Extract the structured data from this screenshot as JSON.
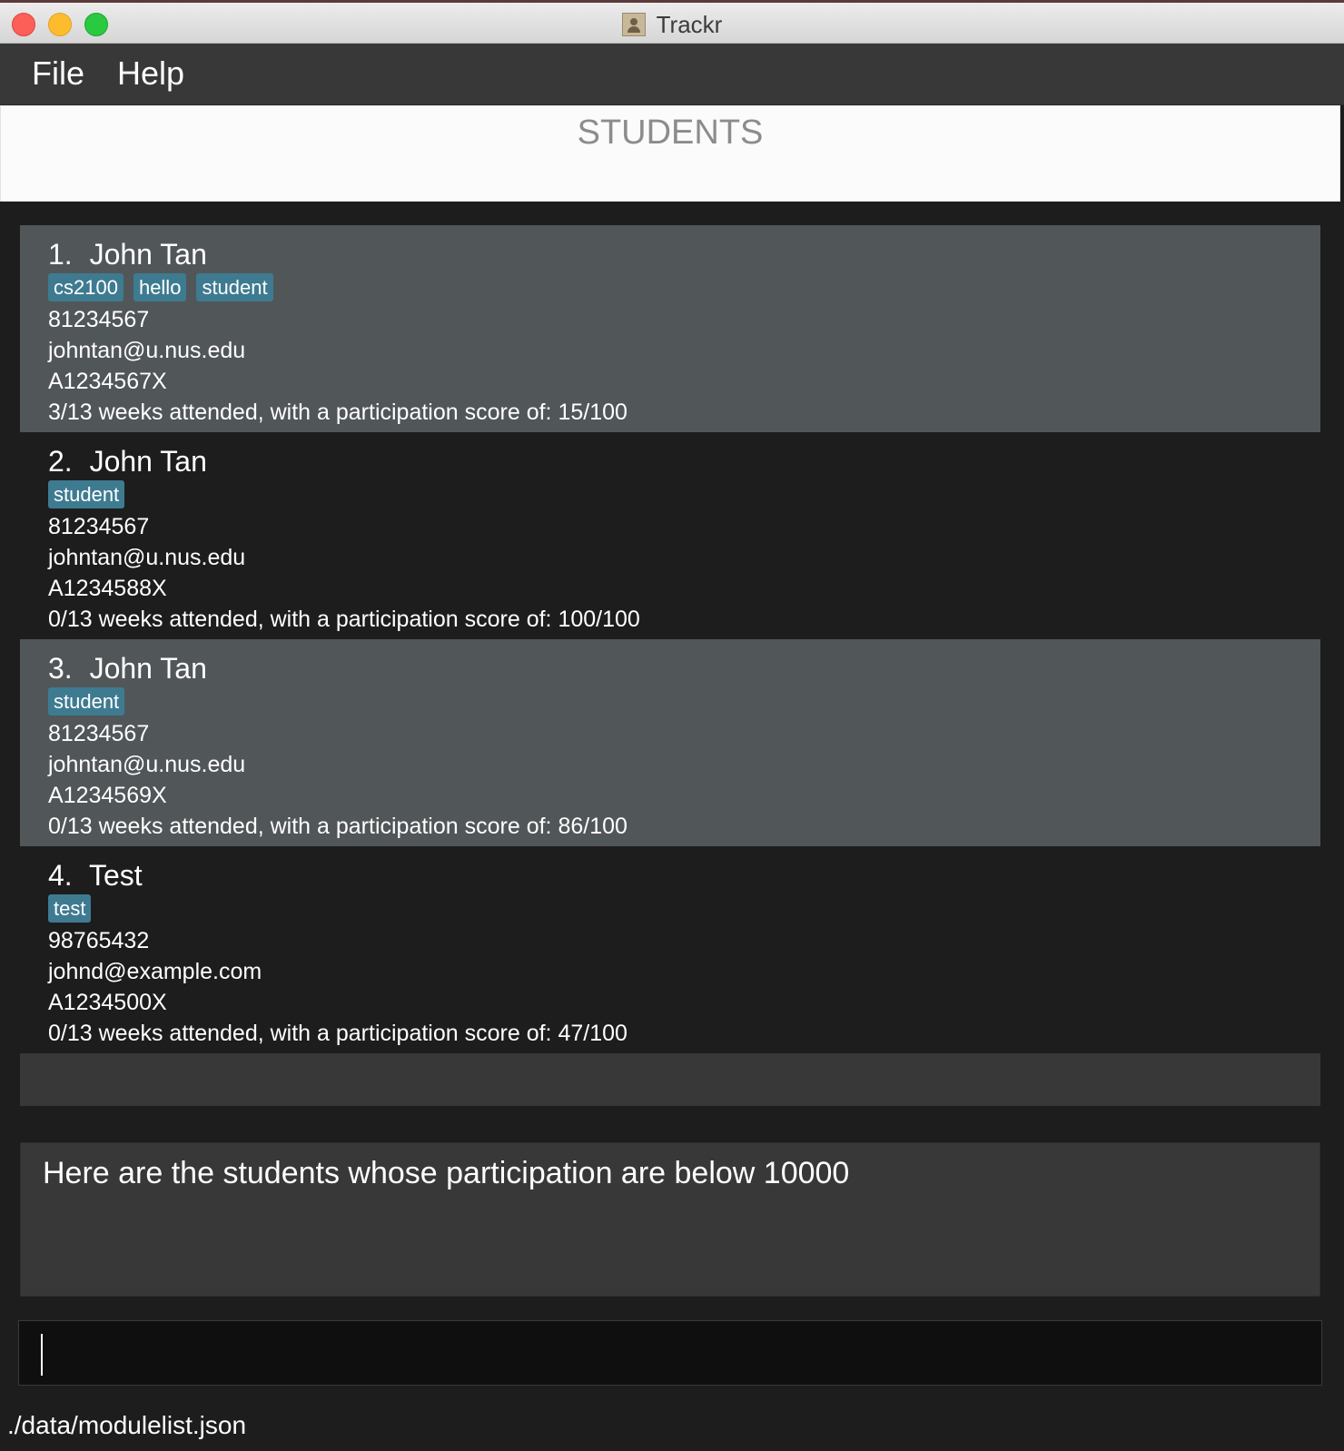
{
  "window": {
    "title": "Trackr"
  },
  "menubar": {
    "file_label": "File",
    "help_label": "Help"
  },
  "header": {
    "title": "STUDENTS"
  },
  "students": [
    {
      "index": "1.",
      "name": "John Tan",
      "tags": [
        "cs2100",
        "hello",
        "student"
      ],
      "phone": "81234567",
      "email": "johntan@u.nus.edu",
      "student_id": "A1234567X",
      "summary": "3/13 weeks attended, with a participation score of: 15/100"
    },
    {
      "index": "2.",
      "name": "John Tan",
      "tags": [
        "student"
      ],
      "phone": "81234567",
      "email": "johntan@u.nus.edu",
      "student_id": "A1234588X",
      "summary": "0/13 weeks attended, with a participation score of: 100/100"
    },
    {
      "index": "3.",
      "name": "John Tan",
      "tags": [
        "student"
      ],
      "phone": "81234567",
      "email": "johntan@u.nus.edu",
      "student_id": "A1234569X",
      "summary": "0/13 weeks attended, with a participation score of: 86/100"
    },
    {
      "index": "4.",
      "name": "Test",
      "tags": [
        "test"
      ],
      "phone": "98765432",
      "email": "johnd@example.com",
      "student_id": "A1234500X",
      "summary": "0/13 weeks attended, with a participation score of: 47/100"
    }
  ],
  "result": {
    "message": "Here are the students whose participation are below 10000"
  },
  "command": {
    "value": ""
  },
  "status": {
    "file_path": "./data/modulelist.json"
  },
  "colors": {
    "tag": "#3e7b91",
    "card_shaded": "#515659",
    "background": "#1d1d1d"
  }
}
